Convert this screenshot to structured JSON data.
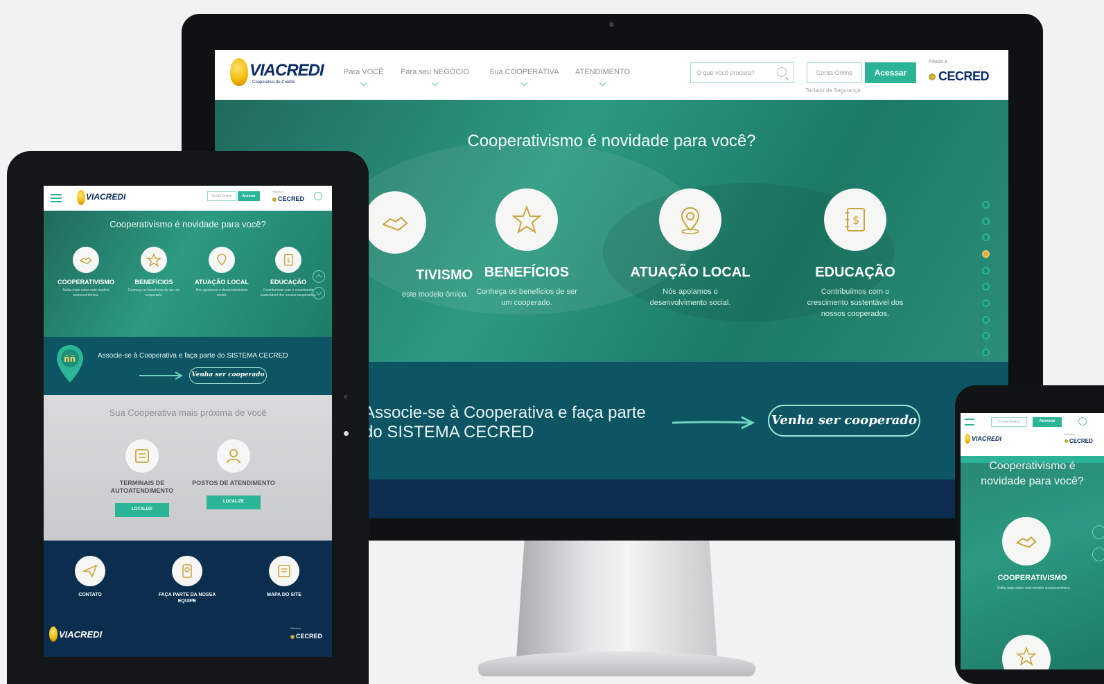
{
  "desktop": {
    "logo": {
      "name": "VIACREDI",
      "tagline": "Cooperativa de Crédito"
    },
    "nav": [
      {
        "label": "Para VOCÊ"
      },
      {
        "label": "Para seu NEGÓCIO"
      },
      {
        "label": "Sua COOPERATIVA"
      },
      {
        "label": "ATENDIMENTO"
      }
    ],
    "search_placeholder": "O que você procura?",
    "conta_online": "Conta Online",
    "acessar": "Acessar",
    "teclado": "Teclado de Segurança",
    "filiada": "Filiada à",
    "cecred": "CECRED",
    "hero_title": "Cooperativismo é novidade para você?",
    "features": [
      {
        "title": "TIVISMO",
        "desc": "este modelo ômico.",
        "icon": "handshake-icon"
      },
      {
        "title": "BENEFÍCIOS",
        "desc": "Conheça os benefícios de ser um cooperado.",
        "icon": "star-icon"
      },
      {
        "title": "ATUAÇÃO LOCAL",
        "desc": "Nós apoiamos o desenvolvimento social.",
        "icon": "map-pin-icon"
      },
      {
        "title": "EDUCAÇÃO",
        "desc": "Contribuímos com o crescimento sustentável dos nossos cooperados.",
        "icon": "notebook-dollar-icon"
      }
    ],
    "cta_text": "Associe-se à Cooperativa e faça parte do SISTEMA CECRED",
    "cta_button": "Venha ser cooperado",
    "accent": "#2bb596",
    "highlight_dot": "#e3a93a"
  },
  "tablet": {
    "logo": "VIACREDI",
    "conta_online": "Conta Online",
    "acessar": "Acessar",
    "filiada": "Filiada à",
    "cecred": "CECRED",
    "hero_title": "Cooperativismo é novidade para você?",
    "features": [
      {
        "title": "COOPERATIVISMO",
        "desc": "Saiba mais sobre este modelo socioeconômico."
      },
      {
        "title": "BENEFÍCIOS",
        "desc": "Conheça os benefícios de ser um cooperado."
      },
      {
        "title": "ATUAÇÃO LOCAL",
        "desc": "Nós apoiamos o desenvolvimento social."
      },
      {
        "title": "EDUCAÇÃO",
        "desc": "Contribuímos com o crescimento sustentável dos nossos cooperados."
      }
    ],
    "cta_text": "Associe-se à Cooperativa e faça parte do SISTEMA CECRED",
    "cta_button": "Venha ser cooperado",
    "nearby_title": "Sua Cooperativa mais próxima de você",
    "services": [
      {
        "title": "TERMINAIS DE AUTOATENDIMENTO",
        "button": "LOCALIZE"
      },
      {
        "title": "POSTOS DE ATENDIMENTO",
        "button": "LOCALIZE"
      }
    ],
    "footer_links": [
      {
        "title": "CONTATO"
      },
      {
        "title": "FAÇA PARTE DA NOSSA EQUIPE"
      },
      {
        "title": "MAPA DO SITE"
      }
    ],
    "footer_logo": "VIACREDI",
    "footer_filiada": "Filiada à",
    "footer_cecred": "CECRED"
  },
  "phone": {
    "conta_online": "Conta Online",
    "acessar": "Acessar",
    "logo": "VIACREDI",
    "filiada": "Filiada à",
    "cecred": "CECRED",
    "hero_title": "Cooperativismo é novidade para você?",
    "feature_title": "COOPERATIVISMO",
    "feature_desc": "Saiba mais sobre este modelo socioeconômico."
  }
}
